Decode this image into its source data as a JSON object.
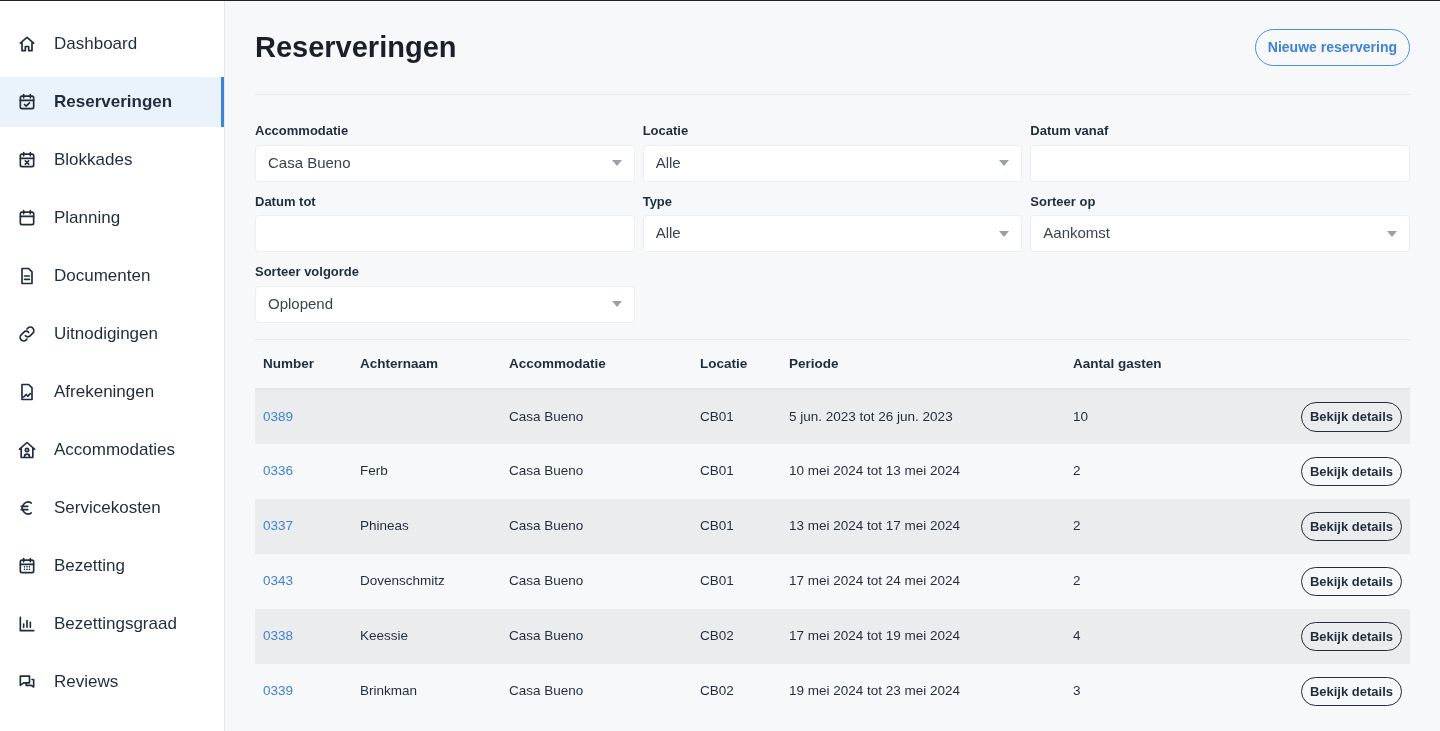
{
  "sidebar": {
    "items": [
      {
        "label": "Dashboard",
        "selected": false
      },
      {
        "label": "Reserveringen",
        "selected": true
      },
      {
        "label": "Blokkades",
        "selected": false
      },
      {
        "label": "Planning",
        "selected": false
      },
      {
        "label": "Documenten",
        "selected": false
      },
      {
        "label": "Uitnodigingen",
        "selected": false
      },
      {
        "label": "Afrekeningen",
        "selected": false
      },
      {
        "label": "Accommodaties",
        "selected": false
      },
      {
        "label": "Servicekosten",
        "selected": false
      },
      {
        "label": "Bezetting",
        "selected": false
      },
      {
        "label": "Bezettingsgraad",
        "selected": false
      },
      {
        "label": "Reviews",
        "selected": false
      }
    ]
  },
  "page": {
    "title": "Reserveringen",
    "new_button": "Nieuwe reservering"
  },
  "filters": [
    {
      "label": "Accommodatie",
      "kind": "select",
      "value": "Casa Bueno"
    },
    {
      "label": "Locatie",
      "kind": "select",
      "value": "Alle"
    },
    {
      "label": "Datum vanaf",
      "kind": "input"
    },
    {
      "label": "Datum tot",
      "kind": "input"
    },
    {
      "label": "Type",
      "kind": "select",
      "value": "Alle"
    },
    {
      "label": "Sorteer op",
      "kind": "select",
      "value": "Aankomst"
    },
    {
      "label": "Sorteer volgorde",
      "kind": "select",
      "value": "Oplopend"
    }
  ],
  "table": {
    "columns": [
      "Number",
      "Achternaam",
      "Accommodatie",
      "Locatie",
      "Periode",
      "Aantal gasten"
    ],
    "rows": [
      {
        "number": "0389",
        "achternaam": "",
        "accommodatie": "Casa Bueno",
        "locatie": "CB01",
        "periode": "5 jun. 2023 tot 26 jun. 2023",
        "gasten": "10",
        "action": "Bekijk details"
      },
      {
        "number": "0336",
        "achternaam": "Ferb",
        "accommodatie": "Casa Bueno",
        "locatie": "CB01",
        "periode": "10 mei 2024 tot 13 mei 2024",
        "gasten": "2",
        "action": "Bekijk details"
      },
      {
        "number": "0337",
        "achternaam": "Phineas",
        "accommodatie": "Casa Bueno",
        "locatie": "CB01",
        "periode": "13 mei 2024 tot 17 mei 2024",
        "gasten": "2",
        "action": "Bekijk details"
      },
      {
        "number": "0343",
        "achternaam": "Dovenschmitz",
        "accommodatie": "Casa Bueno",
        "locatie": "CB01",
        "periode": "17 mei 2024 tot 24 mei 2024",
        "gasten": "2",
        "action": "Bekijk details"
      },
      {
        "number": "0338",
        "achternaam": "Keessie",
        "accommodatie": "Casa Bueno",
        "locatie": "CB02",
        "periode": "17 mei 2024 tot 19 mei 2024",
        "gasten": "4",
        "action": "Bekijk details"
      },
      {
        "number": "0339",
        "achternaam": "Brinkman",
        "accommodatie": "Casa Bueno",
        "locatie": "CB02",
        "periode": "19 mei 2024 tot 23 mei 2024",
        "gasten": "3",
        "action": "Bekijk details"
      }
    ]
  }
}
